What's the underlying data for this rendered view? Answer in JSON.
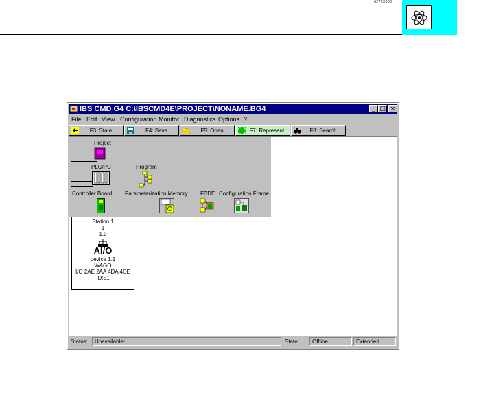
{
  "page_header": {
    "tag": "6270ЭЭ06",
    "logo_icon": "atom-icon",
    "logo_bg": "#00ffff"
  },
  "window": {
    "title": "IBS CMD G4 C:\\IBSCMD4E\\PROJECT\\NONAME.BG4",
    "title_bar_color": "#000080",
    "controls": {
      "minimize": "_",
      "maximize": "□",
      "close": "×"
    }
  },
  "menu": {
    "items": [
      "File",
      "Edit",
      "View",
      "Configuration",
      "Monitor",
      "Diagnostics",
      "Options",
      "?"
    ]
  },
  "toolbar": {
    "buttons": [
      {
        "label": "F3: State",
        "icon": "state-icon"
      },
      {
        "label": "F4: Save",
        "icon": "floppy-icon"
      },
      {
        "label": "F5: Open",
        "icon": "folder-open-icon"
      },
      {
        "label": "F7: Represent.",
        "icon": "represent-icon"
      },
      {
        "label": "F8: Search",
        "icon": "binoculars-icon"
      }
    ]
  },
  "diagram": {
    "project": "Project",
    "plc": "PLC/PC",
    "program": "Program",
    "controller_board": "Controller Board",
    "param_memory": "Parameterization Memory",
    "fbde": "FBDE",
    "config_frame": "Configuration Frame",
    "station": {
      "title": "Station 1",
      "line1": "1",
      "line2": "1.0",
      "module_text": "AI/O",
      "device": "device 1.1",
      "vendor": "WAGO",
      "io": "I/O 2AE 2AA 4DA 4DE",
      "id": "ID:51"
    }
  },
  "status_bar": {
    "status_label": "Status:",
    "status_value": "Unavailable!",
    "state_label": "State:",
    "state_value": "Offline",
    "mode": "Extended"
  }
}
